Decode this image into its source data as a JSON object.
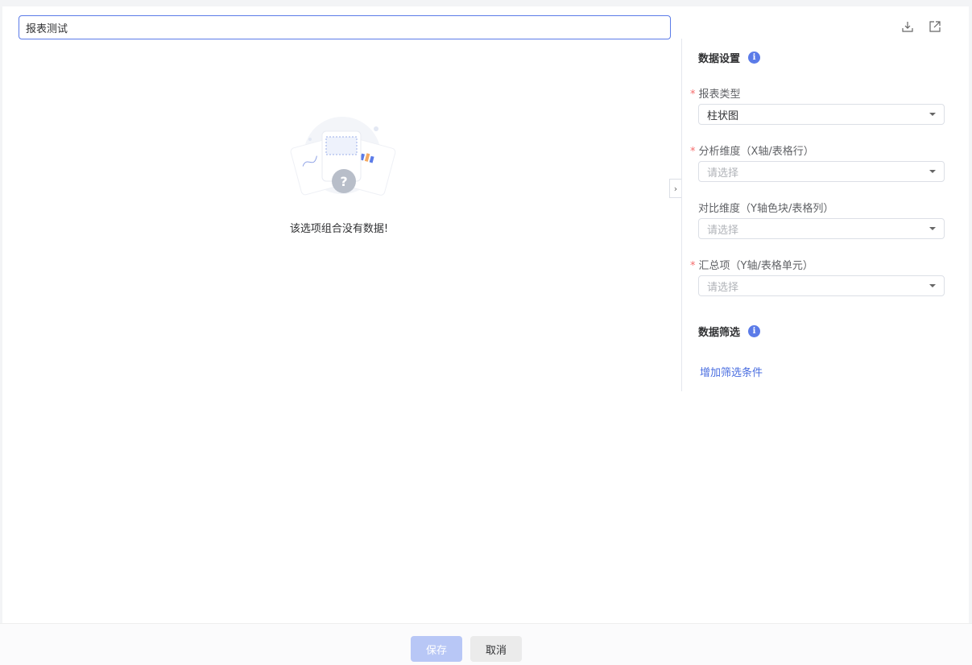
{
  "header": {
    "report_title": "报表测试",
    "download_icon": "download-icon",
    "export_icon": "external-link-icon"
  },
  "empty": {
    "message": "该选项组合没有数据!"
  },
  "sidebar": {
    "data_settings_title": "数据设置",
    "fields": [
      {
        "label": "报表类型",
        "required": true,
        "value": "柱状图",
        "placeholder": ""
      },
      {
        "label": "分析维度（X轴/表格行）",
        "required": true,
        "value": "",
        "placeholder": "请选择"
      },
      {
        "label": "对比维度（Y轴色块/表格列）",
        "required": false,
        "value": "",
        "placeholder": "请选择"
      },
      {
        "label": "汇总项（Y轴/表格单元）",
        "required": true,
        "value": "",
        "placeholder": "请选择"
      }
    ],
    "filter_title": "数据筛选",
    "add_filter": "增加筛选条件"
  },
  "footer": {
    "save": "保存",
    "cancel": "取消"
  },
  "colors": {
    "accent": "#5b7be8",
    "required": "#f56c6c"
  }
}
